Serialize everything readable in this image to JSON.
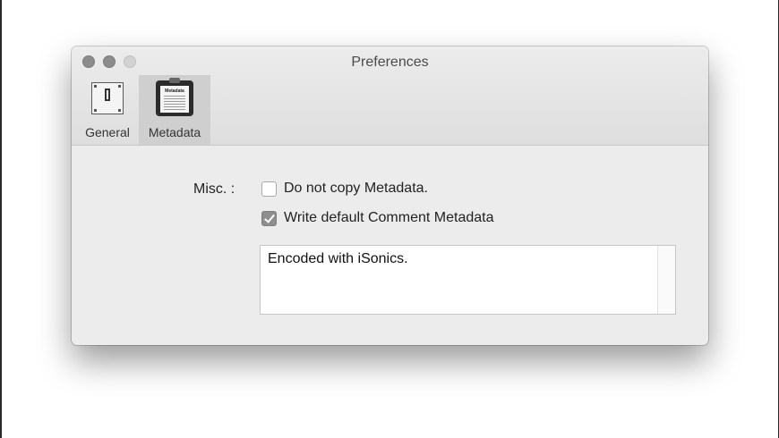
{
  "window": {
    "title": "Preferences"
  },
  "toolbar": {
    "items": [
      {
        "label": "General",
        "icon": "switch-icon",
        "selected": false
      },
      {
        "label": "Metadata",
        "icon": "clipboard-icon",
        "selected": true,
        "icon_text": "Metadata"
      }
    ]
  },
  "misc": {
    "label": "Misc. :",
    "do_not_copy": {
      "label": "Do not copy Metadata.",
      "checked": false
    },
    "write_default": {
      "label": "Write default Comment Metadata",
      "checked": true
    },
    "comment_value": "Encoded with iSonics."
  },
  "colors": {
    "window_bg": "#ececec",
    "selected_tab_bg": "#cfcfcf",
    "checkbox_checked": "#8e8e8e"
  }
}
